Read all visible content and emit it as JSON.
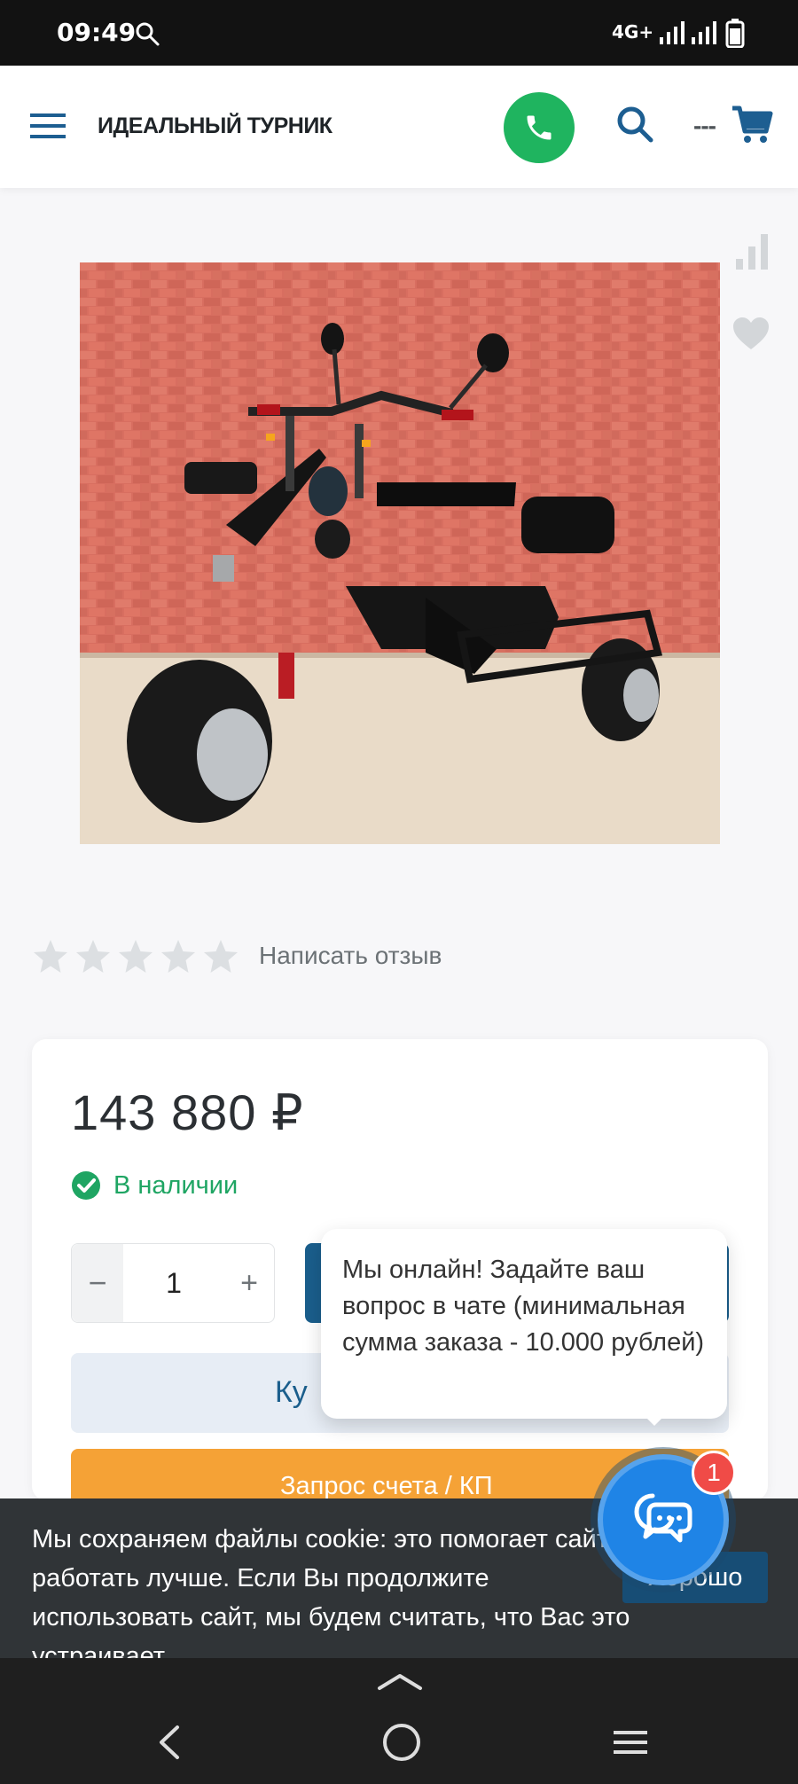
{
  "status_bar": {
    "time": "09:49",
    "network": "4G+",
    "search_icon": "search-icon",
    "signal_icon": "signal-icon",
    "battery_icon": "battery-icon"
  },
  "header": {
    "brand": "ИДЕАЛЬНЫЙ ТУРНИК",
    "cart_placeholder": "---",
    "menu_icon": "hamburger-icon",
    "phone_icon": "phone-icon",
    "search_icon": "search-icon",
    "cart_icon": "cart-icon"
  },
  "product": {
    "image_icon": "electric-trike-photo",
    "compare_icon": "compare-icon",
    "favorite_icon": "heart-icon"
  },
  "reviews": {
    "stars_count": 5,
    "rating": 0,
    "write_review": "Написать отзыв"
  },
  "purchase": {
    "price": "143 880 ₽",
    "stock": "В наличии",
    "quantity": "1",
    "minus": "−",
    "plus": "+",
    "buy_one_click_visible": "Ку",
    "invoice_request": "Запрос счета / КП",
    "brand_color": "#1a5e8c",
    "success_color": "#1fa563",
    "orange_color": "#f5a236"
  },
  "tooltip": {
    "text": "Мы онлайн! Задайте ваш вопрос в чате (минимальная сумма заказа - 10.000 рублей)"
  },
  "cookie": {
    "text": "Мы сохраняем файлы cookie: это помогает сайту работать лучше. Если Вы продолжите использовать сайт, мы будем считать, что Вас это устраивает.",
    "ok_label": "Хорошо"
  },
  "chat": {
    "badge": "1",
    "icon": "chat-bubbles-icon"
  },
  "nav_bar": {
    "back_icon": "back-icon",
    "home_icon": "home-icon",
    "recent_icon": "menu-lines-icon",
    "up_icon": "chevron-up-icon"
  }
}
